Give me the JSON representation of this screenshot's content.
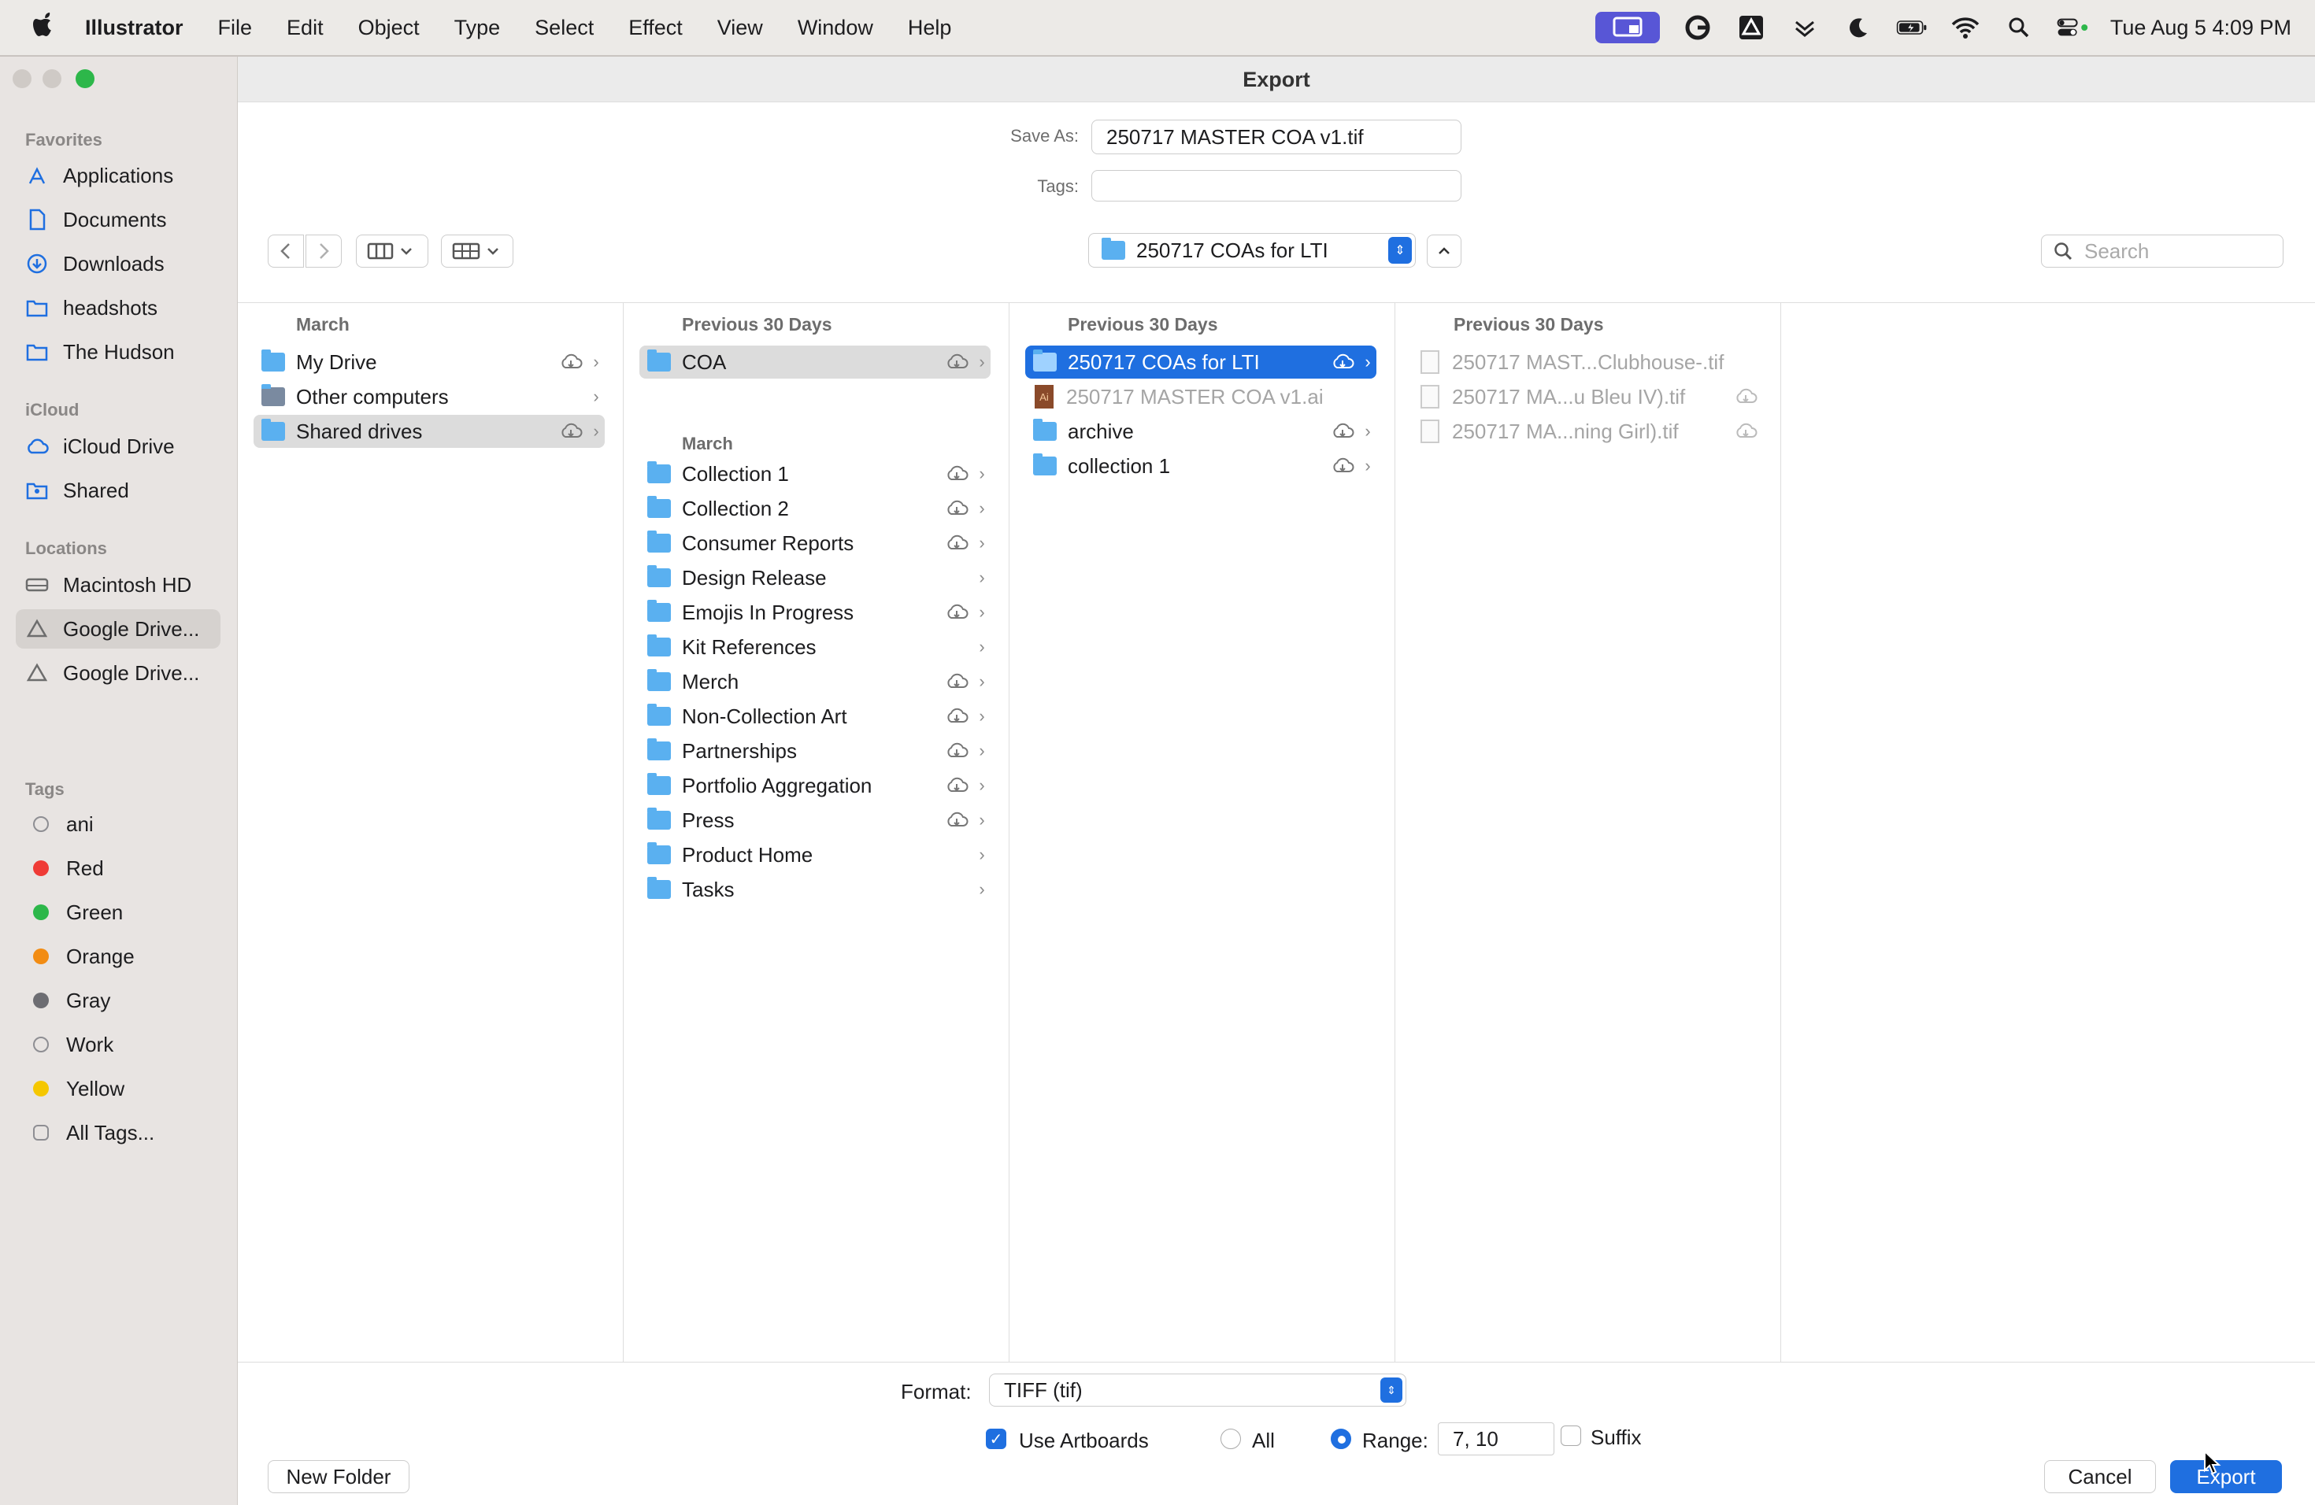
{
  "menubar": {
    "apple": "",
    "items": [
      "Illustrator",
      "File",
      "Edit",
      "Object",
      "Type",
      "Select",
      "Effect",
      "View",
      "Window",
      "Help"
    ],
    "clock": "Tue Aug 5  4:09 PM"
  },
  "dialog": {
    "title": "Export",
    "save_as_label": "Save As:",
    "save_as_value": "250717 MASTER COA v1.tif",
    "tags_label": "Tags:",
    "tags_value": "",
    "current_folder": "250717 COAs for LTI",
    "search_placeholder": "Search"
  },
  "sidebar": {
    "favorites_title": "Favorites",
    "favorites": [
      "Applications",
      "Documents",
      "Downloads",
      "headshots",
      "The Hudson"
    ],
    "icloud_title": "iCloud",
    "icloud": [
      "iCloud Drive",
      "Shared"
    ],
    "locations_title": "Locations",
    "locations": [
      "Macintosh HD",
      "Google Drive...",
      "Google Drive..."
    ],
    "tags_title": "Tags",
    "tags": [
      {
        "label": "ani",
        "color": ""
      },
      {
        "label": "Red",
        "color": "#ef3b36"
      },
      {
        "label": "Green",
        "color": "#2db74a"
      },
      {
        "label": "Orange",
        "color": "#f28c13"
      },
      {
        "label": "Gray",
        "color": "#8e8e93"
      },
      {
        "label": "Work",
        "color": ""
      },
      {
        "label": "Yellow",
        "color": "#f5c700"
      },
      {
        "label": "All Tags...",
        "color": ""
      }
    ]
  },
  "columns": {
    "col1": {
      "header": "March",
      "rows": [
        {
          "name": "My Drive",
          "cloud": true
        },
        {
          "name": "Other computers",
          "cloud": false
        },
        {
          "name": "Shared drives",
          "cloud": true
        }
      ]
    },
    "col2": {
      "header": "Previous 30 Days",
      "top_rows": [
        {
          "name": "COA",
          "cloud": true
        }
      ],
      "sub_header": "March",
      "rows": [
        {
          "name": "Collection 1",
          "cloud": true
        },
        {
          "name": "Collection 2",
          "cloud": true
        },
        {
          "name": "Consumer Reports",
          "cloud": true
        },
        {
          "name": "Design Release",
          "cloud": false
        },
        {
          "name": "Emojis In Progress",
          "cloud": true
        },
        {
          "name": "Kit References",
          "cloud": false
        },
        {
          "name": "Merch",
          "cloud": true
        },
        {
          "name": "Non-Collection Art",
          "cloud": true
        },
        {
          "name": "Partnerships",
          "cloud": true
        },
        {
          "name": "Portfolio Aggregation",
          "cloud": true
        },
        {
          "name": "Press",
          "cloud": true
        },
        {
          "name": "Product Home",
          "cloud": false
        },
        {
          "name": "Tasks",
          "cloud": false
        }
      ]
    },
    "col3": {
      "header": "Previous 30 Days",
      "rows": [
        {
          "name": "250717 COAs for LTI",
          "cloud": true
        },
        {
          "name": "250717 MASTER COA v1.ai",
          "cloud": false
        },
        {
          "name": "archive",
          "cloud": true
        },
        {
          "name": "collection 1",
          "cloud": true
        }
      ]
    },
    "col4": {
      "header": "Previous 30 Days",
      "rows": [
        {
          "name": "250717 MAST...Clubhouse-.tif",
          "cloud": false
        },
        {
          "name": "250717 MA...u Bleu IV).tif",
          "cloud": true
        },
        {
          "name": "250717 MA...ning Girl).tif",
          "cloud": true
        }
      ]
    }
  },
  "options": {
    "format_label": "Format:",
    "format_value": "TIFF (tif)",
    "use_artboards_label": "Use Artboards",
    "use_artboards_checked": true,
    "all_label": "All",
    "range_label": "Range:",
    "range_value": "7, 10",
    "suffix_label": "Suffix"
  },
  "buttons": {
    "new_folder": "New Folder",
    "cancel": "Cancel",
    "export": "Export"
  },
  "colors": {
    "accent": "#1f6fe0",
    "folder": "#5ab0f0"
  }
}
